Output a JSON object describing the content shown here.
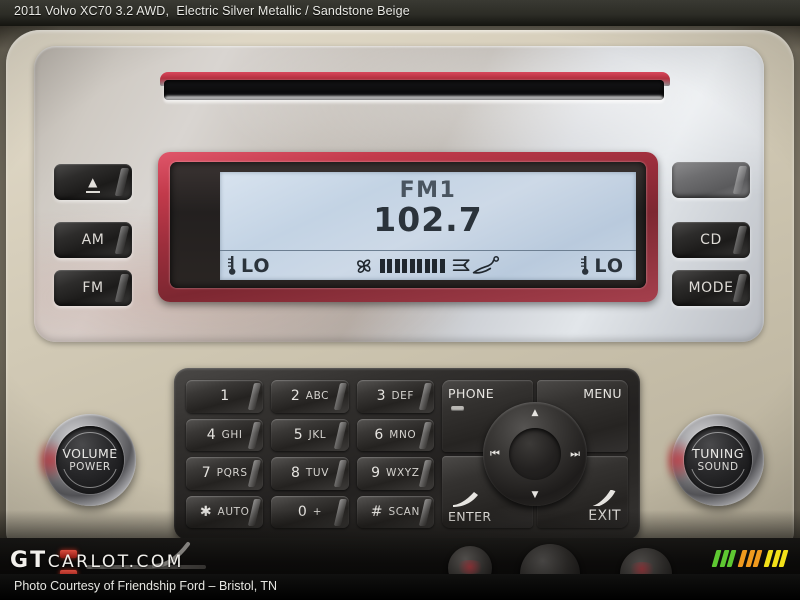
{
  "topbar": {
    "vehicle": "2011 Volvo XC70 3.2 AWD,",
    "colors": "Electric Silver Metallic / Sandstone Beige"
  },
  "bottombar": {
    "credit": "Photo Courtesy of Friendship Ford – Bristol, TN"
  },
  "watermark": {
    "prefix": "GT",
    "suffix": "CARLOT.COM",
    "bar_colors": [
      "#5ec832",
      "#f09a1e",
      "#f2e019"
    ]
  },
  "display": {
    "band": "FM1",
    "frequency": "102.7",
    "temp_left": "LO",
    "temp_right": "LO",
    "fan_level": 9,
    "fan_icon": "fan-icon",
    "airflow_icon": "airflow-to-body-icon",
    "thermometer_icon": "thermometer-icon"
  },
  "left_buttons": [
    {
      "label": "",
      "icon": "eject-icon",
      "glyph": "▲",
      "name": "eject-button"
    },
    {
      "label": "AM",
      "icon": "",
      "glyph": "",
      "name": "am-button"
    },
    {
      "label": "FM",
      "icon": "",
      "glyph": "",
      "name": "fm-button"
    }
  ],
  "right_buttons": [
    {
      "label": "",
      "icon": "",
      "glyph": "",
      "name": "blank-button"
    },
    {
      "label": "CD",
      "icon": "",
      "glyph": "",
      "name": "cd-button"
    },
    {
      "label": "MODE",
      "icon": "",
      "glyph": "",
      "name": "mode-button"
    }
  ],
  "knobs": {
    "left": {
      "line1": "VOLUME",
      "line2": "POWER"
    },
    "right": {
      "line1": "TUNING",
      "line2": "SOUND"
    }
  },
  "keypad": [
    {
      "num": "1",
      "alpha": ""
    },
    {
      "num": "2",
      "alpha": "ABC"
    },
    {
      "num": "3",
      "alpha": "DEF"
    },
    {
      "num": "4",
      "alpha": "GHI"
    },
    {
      "num": "5",
      "alpha": "JKL"
    },
    {
      "num": "6",
      "alpha": "MNO"
    },
    {
      "num": "7",
      "alpha": "PQRS"
    },
    {
      "num": "8",
      "alpha": "TUV"
    },
    {
      "num": "9",
      "alpha": "WXYZ"
    },
    {
      "num": "✱",
      "alpha": "AUTO"
    },
    {
      "num": "0",
      "alpha": "+"
    },
    {
      "num": "#",
      "alpha": "SCAN"
    }
  ],
  "nav": {
    "phone": "PHONE",
    "menu": "MENU",
    "enter": "ENTER",
    "exit": "EXIT",
    "up_glyph": "▲",
    "down_glyph": "▼",
    "prev_glyph": "⏮",
    "next_glyph": "⏭"
  },
  "climate": {
    "auto_label": "AUTO"
  }
}
